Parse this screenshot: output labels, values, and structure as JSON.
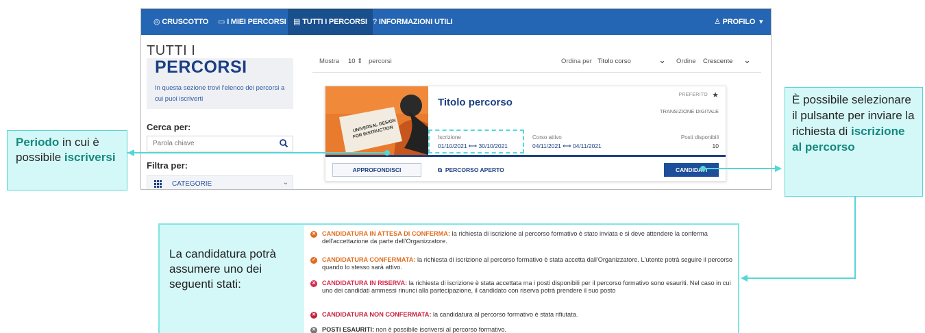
{
  "navbar": {
    "items": [
      {
        "icon": "dashboard-icon",
        "label": "CRUSCOTTO"
      },
      {
        "icon": "monitor-icon",
        "label": "I MIEI PERCORSI"
      },
      {
        "icon": "list-icon",
        "label": "TUTTI I PERCORSI"
      },
      {
        "icon": "help-icon",
        "label": "INFORMAZIONI UTILI"
      }
    ],
    "profile_label": "PROFILO",
    "colors": {
      "bar": "#2566b4",
      "active": "#1a4f8e"
    }
  },
  "sidebar": {
    "title_line1": "TUTTI I",
    "title_line2": "PERCORSI",
    "description": "In questa sezione trovi l'elenco dei percorsi a cui puoi iscriverti",
    "search_label": "Cerca per:",
    "search_placeholder": "Parola chiave",
    "filter_label": "Filtra per:",
    "category_label": "CATEGORIE"
  },
  "toolbar": {
    "show_label": "Mostra",
    "show_value": "10",
    "items_label": "percorsi",
    "sort_label": "Ordina per",
    "sort_value": "Titolo corso",
    "order_label": "Ordine",
    "order_value": "Crescente"
  },
  "card": {
    "image_text": "UNIVERSAL DESIGN FOR INSTRUCTION",
    "title": "Titolo percorso",
    "favorite_label": "PREFERITO",
    "category": "TRANSIZIONE DIGITALE",
    "enrollment_label": "Iscrizione",
    "enrollment_start": "01/10/2021",
    "enrollment_end": "30/10/2021",
    "active_label": "Corso attivo",
    "active_start": "04/11/2021",
    "active_end": "04/11/2021",
    "seats_label": "Posti disponibili",
    "seats_value": "10",
    "details_button": "APPROFONDISCI",
    "open_label": "PERCORSO APERTO",
    "apply_button": "CANDIDATI"
  },
  "callouts": {
    "periodo": {
      "bold": "Periodo",
      "rest": " in cui è possibile ",
      "bold2": "iscriversi"
    },
    "candidati": {
      "text": "È possibile selezionare il pulsante per inviare la richiesta di ",
      "bold": "iscrizione al percorso"
    }
  },
  "statuses": {
    "intro": "La candidatura potrà assumere uno dei seguenti stati:",
    "items": [
      {
        "name": "CANDIDATURA IN ATTESA DI CONFERMA:",
        "text": " la richiesta di iscrizione al percorso formativo è stato inviata e si deve attendere la conferma dell'accettazione da parte dell'Organizzatore.",
        "color": "#e06c1f",
        "glyph": "✕"
      },
      {
        "name": "CANDIDATURA CONFERMATA:",
        "text": " la richiesta di iscrizione al percorso formativo è stata accetta dall'Organizzatore. L'utente potrà seguire il percorso quando lo stesso sarà attivo.",
        "color": "#e06c1f",
        "glyph": "✓"
      },
      {
        "name": "CANDIDATURA IN RISERVA:",
        "text": " la richiesta di iscrizione è stata accettata ma i posti disponibili per il percorso formativo sono esauriti. Nel caso in cui uno dei candidati ammessi rinunci alla partecipazione, il candidato con riserva potrà prendere il suo posto",
        "color": "#d6294d",
        "glyph": "✕"
      },
      {
        "name": "CANDIDATURA NON CONFERMATA:",
        "text": " la candidatura al percorso formativo è stata rifiutata.",
        "color": "#c81d3a",
        "glyph": "✕"
      },
      {
        "name": "POSTI ESAURITI:",
        "text": " non è possibile iscriversi al percorso formativo.",
        "color": "#777777",
        "glyph": "✕"
      }
    ]
  }
}
